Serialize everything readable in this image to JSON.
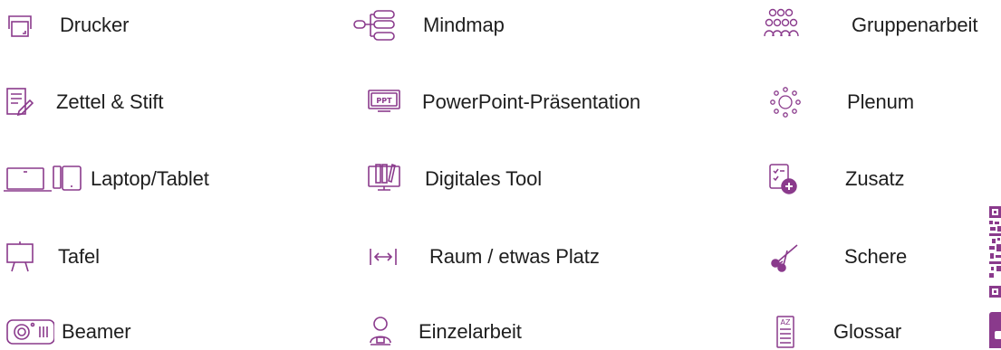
{
  "theme": {
    "accent": "#8a3a8c",
    "text": "#1e1e1e",
    "background": "#ffffff"
  },
  "legend": {
    "col1": [
      {
        "label": "Drucker",
        "icon": "printer-icon"
      },
      {
        "label": "Zettel & Stift",
        "icon": "paper-pen-icon"
      },
      {
        "label": "Laptop/Tablet",
        "icon": "laptop-tablet-icon"
      },
      {
        "label": "Tafel",
        "icon": "board-icon"
      },
      {
        "label": "Beamer",
        "icon": "projector-icon"
      }
    ],
    "col2": [
      {
        "label": "Mindmap",
        "icon": "mindmap-icon"
      },
      {
        "label": "PowerPoint-Präsentation",
        "icon": "presentation-icon",
        "icon_text": "PPT"
      },
      {
        "label": "Digitales Tool",
        "icon": "digital-tool-icon"
      },
      {
        "label": "Raum / etwas Platz",
        "icon": "space-icon"
      },
      {
        "label": "Einzelarbeit",
        "icon": "single-work-icon"
      }
    ],
    "col3": [
      {
        "label": "Gruppenarbeit",
        "icon": "group-work-icon"
      },
      {
        "label": "Plenum",
        "icon": "plenum-icon"
      },
      {
        "label": "Zusatz",
        "icon": "addition-icon"
      },
      {
        "label": "Schere",
        "icon": "scissors-icon"
      },
      {
        "label": "Glossar",
        "icon": "glossary-icon",
        "icon_text": "AZ"
      }
    ]
  }
}
